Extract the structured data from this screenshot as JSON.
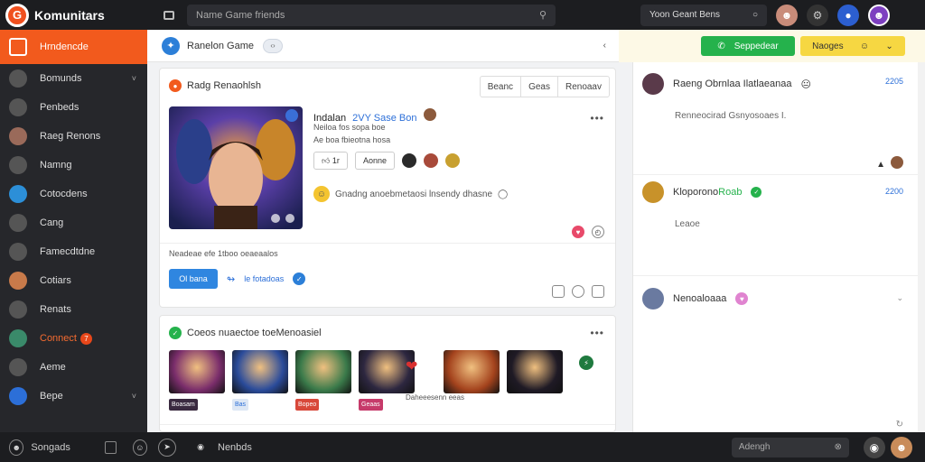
{
  "app": {
    "title": "Komunitars"
  },
  "topbar": {
    "search_placeholder": "Name  Game friends",
    "right_search_label": "Yoon Geant Bens"
  },
  "sidebar": {
    "items": [
      {
        "label": "Hrndencde",
        "icon": "home-icon",
        "active": true
      },
      {
        "label": "Bomunds",
        "icon": "community-icon",
        "chevron": "˅"
      },
      {
        "label": "Penbeds",
        "icon": "tag-icon"
      },
      {
        "label": "Raeg Renons",
        "icon": "avatar-icon"
      },
      {
        "label": "Namng",
        "icon": "chart-icon"
      },
      {
        "label": "Cotocdens",
        "icon": "globe-icon"
      },
      {
        "label": "Cang",
        "icon": "chat-icon"
      },
      {
        "label": "Famecdtdne",
        "icon": "monitor-icon"
      },
      {
        "label": "Cotiars",
        "icon": "person-icon"
      },
      {
        "label": "Renats",
        "icon": "report-icon"
      },
      {
        "label": "Connect",
        "icon": "connect-icon",
        "badge": "7"
      },
      {
        "label": "Aeme",
        "icon": "cloud-icon"
      },
      {
        "label": "Bepe",
        "icon": "image-icon",
        "chevron": "˅"
      }
    ]
  },
  "bottombar": {
    "left_label": "Songads",
    "mid_label": "Nenbds",
    "search_label": "Adengh"
  },
  "main_header": {
    "title": "Ranelon Game",
    "pill": "‹›",
    "end": "‹"
  },
  "right_header": {
    "green_button": "Seppedear",
    "yellow_button": "Naoges"
  },
  "post": {
    "header": "Radg Renaohlsh",
    "tabs": [
      "Beanc",
      "Geas",
      "Renoaav"
    ],
    "title": "Indalan",
    "title_blue": "2VY Sase Bon",
    "sub1": "Neiloa fos  sopa boe",
    "sub2": "Ae  boa  fbieotna hosa",
    "like_label": "1r",
    "btn_label": "Aonne",
    "comment": "Gnadng  anoebmetaosi lnsendy dhasne",
    "meta": "Neadeae efe  1tboo oeaeaalos",
    "action_button": "Ol  bana",
    "action_link": "le  fotadoas"
  },
  "collection": {
    "header": "Coeos  nuaectoe  toeMenoasiel",
    "thumbs": [
      {
        "label": "Boasam",
        "color": "#7a2d6b"
      },
      {
        "label": "Bas",
        "color": "#2a4b9a"
      },
      {
        "label": "Bopeo",
        "color": "#3a7a4a"
      },
      {
        "label": "Geaas",
        "color": "#2d2740"
      },
      {
        "label": "",
        "color": "#a4431d"
      },
      {
        "label": "",
        "color": "#1f1a25"
      }
    ],
    "caption": "Daheeesenn eeas"
  },
  "chat": {
    "messages": [
      {
        "name": "Raeng Obrnlaa Ilatlaeanaa",
        "time": "2205",
        "text": "Renneocirad  Gsnyosoaes  I."
      },
      {
        "name": "Kloporono",
        "name_green": "Roab",
        "time": "2200",
        "text": "Leaoe"
      },
      {
        "name": "Nenoaloaaa",
        "time": "",
        "text": ""
      }
    ]
  }
}
